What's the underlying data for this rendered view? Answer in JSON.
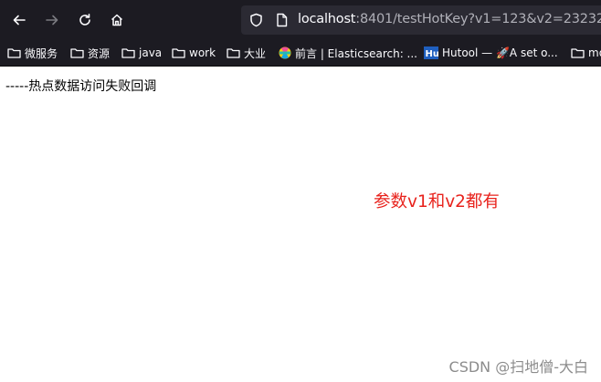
{
  "browser": {
    "nav": {
      "back_icon": "arrow-left-icon",
      "forward_icon": "arrow-right-icon",
      "reload_icon": "reload-icon",
      "home_icon": "home-icon"
    },
    "url": {
      "host": "localhost",
      "rest": ":8401/testHotKey?v1=123&v2=23232"
    },
    "bookmarks": [
      {
        "label": "微服务",
        "icon": "folder-icon"
      },
      {
        "label": "资源",
        "icon": "folder-icon"
      },
      {
        "label": "java",
        "icon": "folder-icon"
      },
      {
        "label": "work",
        "icon": "folder-icon"
      },
      {
        "label": "大业",
        "icon": "folder-icon"
      },
      {
        "label": "前言 | Elasticsearch: ...",
        "icon": "elastic-logo-icon"
      },
      {
        "label": "Hutool — 🚀A set o...",
        "icon": "hutool-logo-icon"
      },
      {
        "label": "mo",
        "icon": "folder-icon"
      }
    ]
  },
  "page": {
    "body_text": "-----热点数据访问失败回调",
    "note": "参数v1和v2都有",
    "watermark": "CSDN @扫地僧-大白"
  },
  "colors": {
    "toolbar_bg": "#1c1b22",
    "urlbar_bg": "#2b2a33",
    "note_red": "#e8221c"
  }
}
